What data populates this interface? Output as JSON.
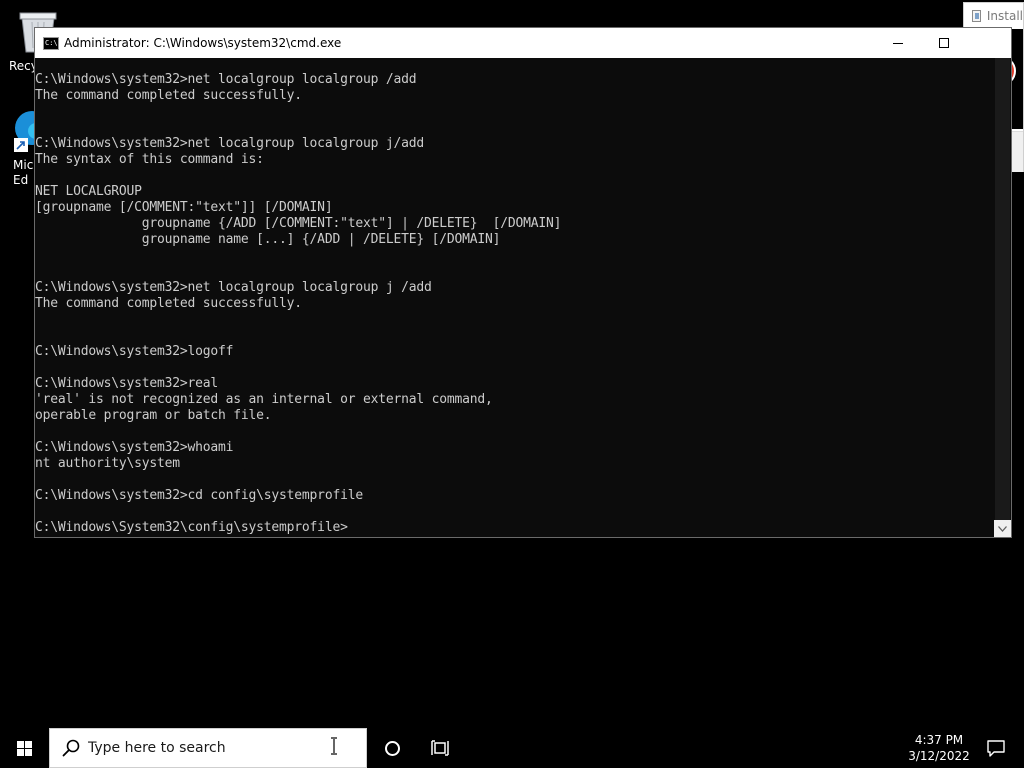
{
  "desktop": {
    "icons": [
      {
        "label": "Recy",
        "icon": "recycle-bin-icon"
      },
      {
        "label": "Mic\nEd",
        "icon": "edge-icon"
      }
    ]
  },
  "installer": {
    "title": "Install",
    "icon": "error-icon",
    "error_color": "#e03b2a"
  },
  "cmd": {
    "title": "Administrator: C:\\Windows\\system32\\cmd.exe",
    "lines": [
      "C:\\Windows\\system32>net localgroup localgroup /add",
      "The command completed successfully.",
      "",
      "",
      "C:\\Windows\\system32>net localgroup localgroup j/add",
      "The syntax of this command is:",
      "",
      "NET LOCALGROUP",
      "[groupname [/COMMENT:\"text\"]] [/DOMAIN]",
      "              groupname {/ADD [/COMMENT:\"text\"] | /DELETE}  [/DOMAIN]",
      "              groupname name [...] {/ADD | /DELETE} [/DOMAIN]",
      "",
      "",
      "C:\\Windows\\system32>net localgroup localgroup j /add",
      "The command completed successfully.",
      "",
      "",
      "C:\\Windows\\system32>logoff",
      "",
      "C:\\Windows\\system32>real",
      "'real' is not recognized as an internal or external command,",
      "operable program or batch file.",
      "",
      "C:\\Windows\\system32>whoami",
      "nt authority\\system",
      "",
      "C:\\Windows\\system32>cd config\\systemprofile",
      "",
      "C:\\Windows\\System32\\config\\systemprofile>"
    ],
    "colors": {
      "background": "#0c0c0c",
      "text": "#cccccc"
    }
  },
  "taskbar": {
    "search_placeholder": "Type here to search",
    "time": "4:37 PM",
    "date": "3/12/2022"
  }
}
